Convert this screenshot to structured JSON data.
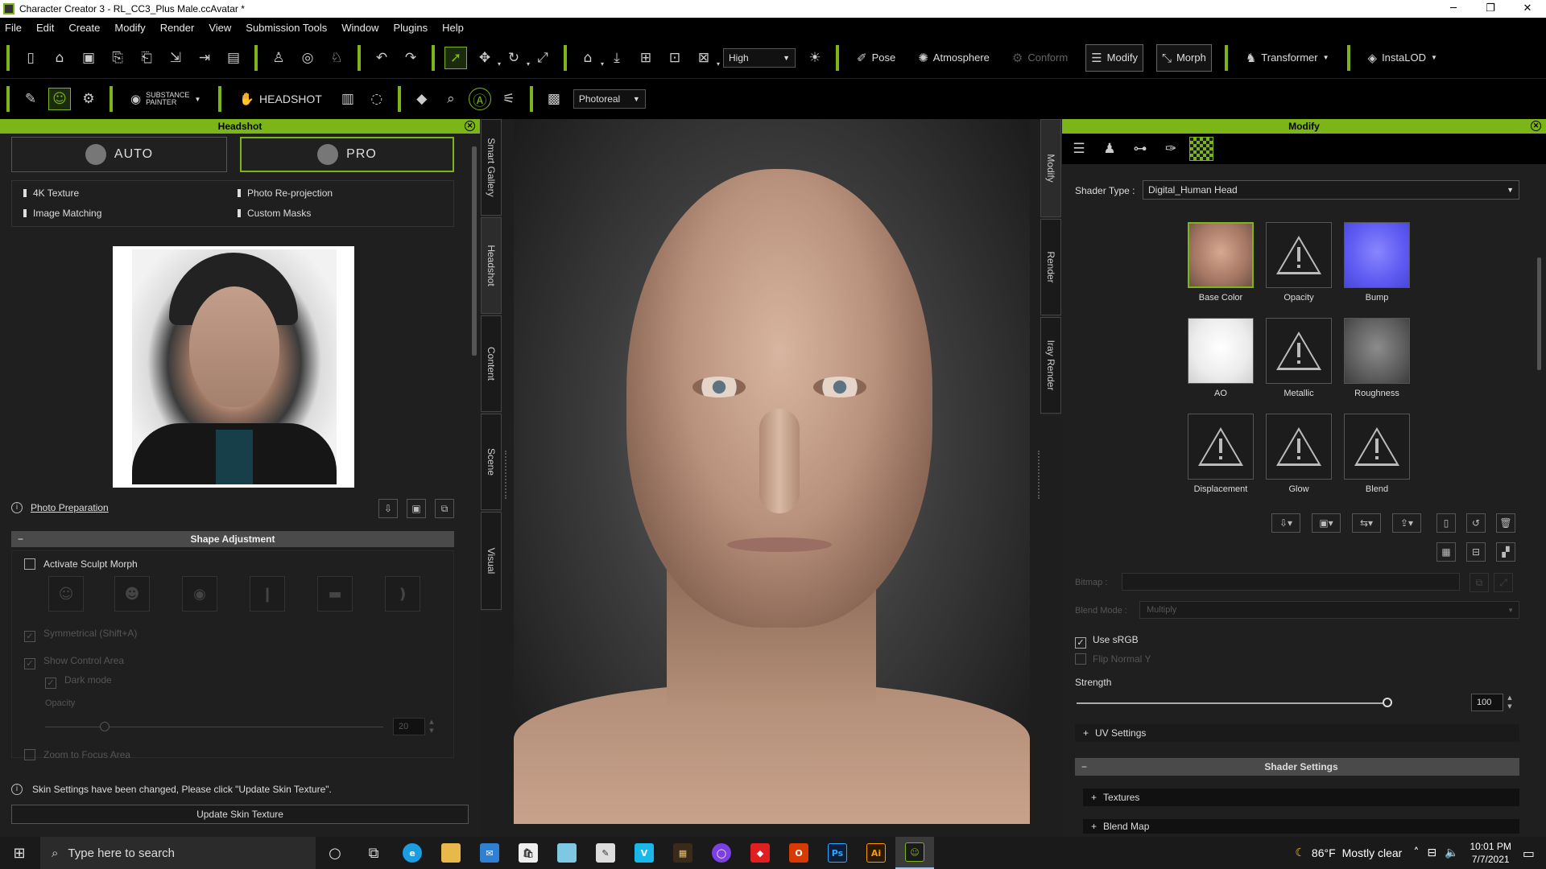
{
  "window": {
    "title": "Character Creator 3 - RL_CC3_Plus Male.ccAvatar *",
    "minimize": "─",
    "maximize": "❐",
    "close": "✕"
  },
  "menu": [
    "File",
    "Edit",
    "Create",
    "Modify",
    "Render",
    "View",
    "Submission Tools",
    "Window",
    "Plugins",
    "Help"
  ],
  "toolbar1": {
    "quality": "High",
    "pose": "Pose",
    "atmosphere": "Atmosphere",
    "conform": "Conform",
    "modify": "Modify",
    "morph": "Morph",
    "transformer": "Transformer",
    "instalod": "InstaLOD"
  },
  "toolbar2": {
    "substance_line1": "SUBSTANCE",
    "substance_line2": "PAINTER",
    "headshot": "HEADSHOT",
    "render_mode": "Photoreal"
  },
  "headshot_panel": {
    "title": "Headshot",
    "auto": "AUTO",
    "pro": "PRO",
    "features": [
      "4K Texture",
      "Photo Re-projection",
      "Image Matching",
      "Custom Masks"
    ],
    "photo_prep": "Photo Preparation",
    "shape_adjustment": "Shape Adjustment",
    "shape_toggle": "−",
    "activate_sculpt": "Activate Sculpt Morph",
    "symmetrical": "Symmetrical (Shift+A)",
    "show_control": "Show Control Area",
    "dark_mode": "Dark mode",
    "opacity_label": "Opacity",
    "opacity_value": "20",
    "zoom_focus": "Zoom to Focus Area",
    "skin_notice": "Skin Settings have been changed, Please click \"Update Skin Texture\".",
    "update_btn": "Update Skin Texture"
  },
  "left_tabs": [
    "Smart Gallery",
    "Headshot",
    "Content",
    "Scene",
    "Visual"
  ],
  "right_tabs": [
    "Modify",
    "Render",
    "Iray Render"
  ],
  "modify_panel": {
    "title": "Modify",
    "shader_type_label": "Shader Type :",
    "shader_type": "Digital_Human Head",
    "textures": [
      {
        "label": "Base Color",
        "state": "image"
      },
      {
        "label": "Opacity",
        "state": "missing"
      },
      {
        "label": "Bump",
        "state": "image"
      },
      {
        "label": "AO",
        "state": "image"
      },
      {
        "label": "Metallic",
        "state": "missing"
      },
      {
        "label": "Roughness",
        "state": "image"
      },
      {
        "label": "Displacement",
        "state": "missing"
      },
      {
        "label": "Glow",
        "state": "missing"
      },
      {
        "label": "Blend",
        "state": "missing"
      }
    ],
    "bitmap_label": "Bitmap :",
    "blend_mode_label": "Blend Mode :",
    "blend_mode": "Multiply",
    "use_srgb": "Use sRGB",
    "flip_normal": "Flip Normal Y",
    "strength_label": "Strength",
    "strength_value": "100",
    "strength_level": 1.0,
    "uv_settings": "UV Settings",
    "shader_settings": "Shader Settings",
    "textures_section": "Textures",
    "blend_map": "Blend Map"
  },
  "taskbar": {
    "search": "Type here to search",
    "temp": "86°F",
    "weather": "Mostly clear",
    "time": "10:01 PM",
    "date": "7/7/2021"
  },
  "colors": {
    "accent": "#7cb518"
  }
}
